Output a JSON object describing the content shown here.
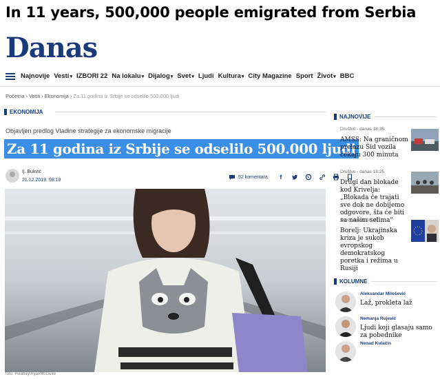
{
  "caption": "In 11 years, 500,000 people emigrated from Serbia",
  "site": {
    "logo": "Danas",
    "brand_color": "#1a3a7a",
    "highlight_color": "#3a8ee6"
  },
  "nav": {
    "items": [
      {
        "label": "Najnovije",
        "caret": false
      },
      {
        "label": "Vesti",
        "caret": true
      },
      {
        "label": "IZBORI 22",
        "caret": false
      },
      {
        "label": "Na lokalu",
        "caret": true
      },
      {
        "label": "Dijalog",
        "caret": true
      },
      {
        "label": "Svet",
        "caret": true
      },
      {
        "label": "Ljudi",
        "caret": false
      },
      {
        "label": "Kultura",
        "caret": true
      },
      {
        "label": "City Magazine",
        "caret": false
      },
      {
        "label": "Sport",
        "caret": false
      },
      {
        "label": "Život",
        "caret": true
      },
      {
        "label": "BBC",
        "caret": false
      }
    ]
  },
  "breadcrumb": {
    "items": [
      "Početna",
      "Vesti",
      "Ekonomija"
    ],
    "current": "Za 11 godina iz Srbije se odselilo 500.000 ljudi"
  },
  "article": {
    "section": "EKONOMIJA",
    "lead": "Objavljen predlog Vladine strategije za ekonomske migracije",
    "headline": "Za 11 godina iz Srbije se odselilo 500.000 ljudi",
    "author": "Ij. Bukvić",
    "date": "21.12.2019. 08:18",
    "comments": "52 komentara",
    "photo_credit": "foto: Pixabay/RyanMcGuire"
  },
  "sidebar": {
    "latest_label": "NAJNOVIJE",
    "latest": [
      {
        "meta": "Društvo - danas 18:35",
        "title": "AMSS: Na graničnom prelazu Šid vozila čekaju 300 minuta"
      },
      {
        "meta": "Društvo - danas 18:25",
        "title": "Drugi dan blokade kod Krivelja: „Blokada će trajati sve dok ne dobijemo odgovore, šta će biti sa našim selima\""
      },
      {
        "meta": "Svet - danas 18:12",
        "title": "Borelj: Ukrajinska kriza je sukob evropskog demokratskog poretka i režima u Rusiji"
      }
    ],
    "columns_label": "KOLUMNE",
    "columns": [
      {
        "author": "Aleksandar Milošević",
        "title": "Laž, prokleta laž"
      },
      {
        "author": "Nemanja Rujević",
        "title": "Ljudi koji glasaju samo za pobednike"
      },
      {
        "author": "Nenad Kulačin",
        "title": ""
      }
    ]
  }
}
